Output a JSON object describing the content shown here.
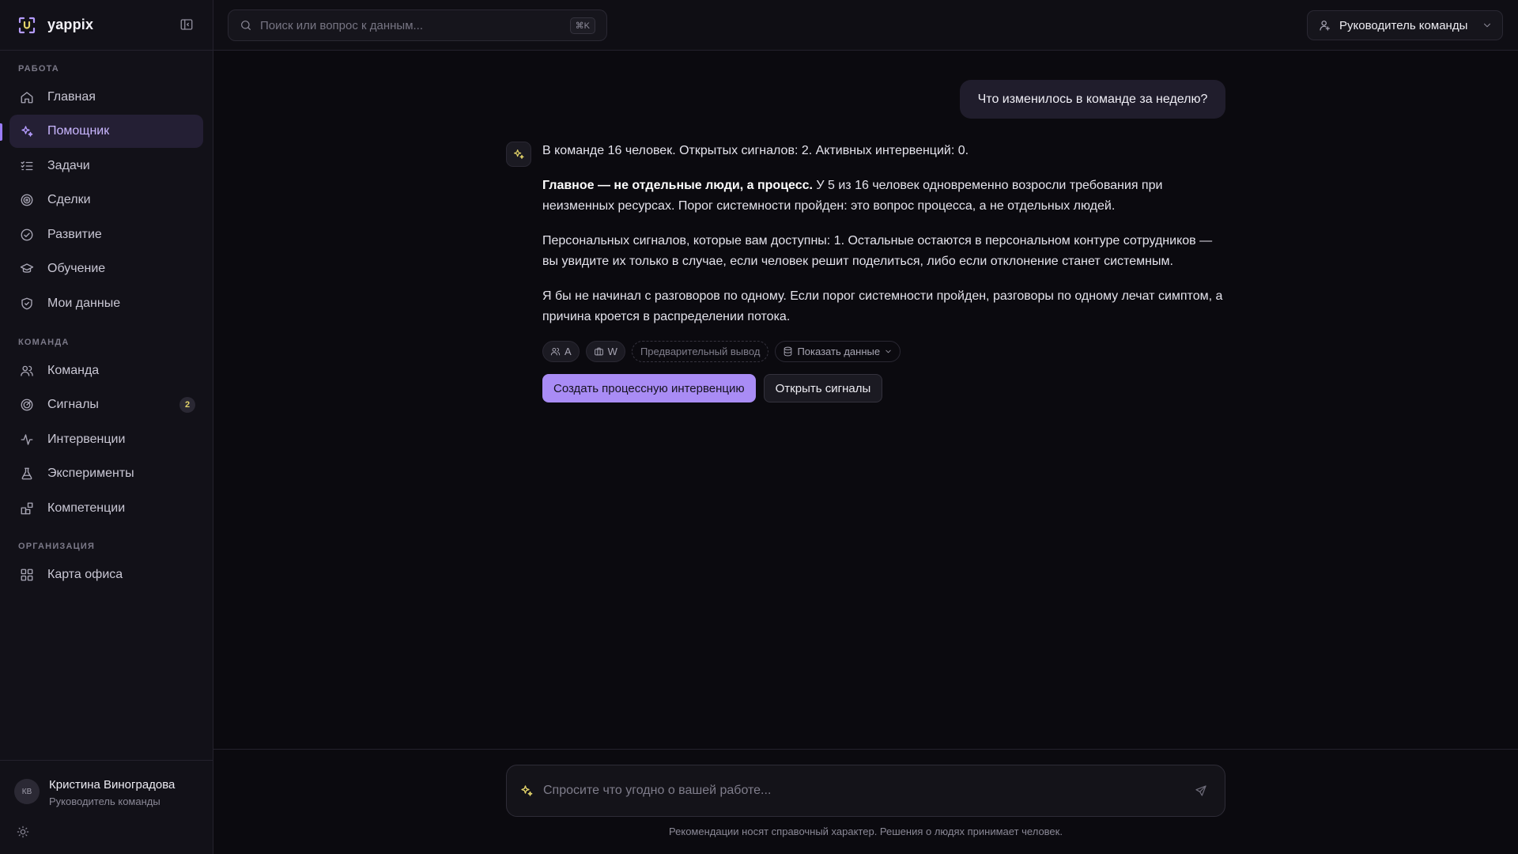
{
  "app": {
    "name": "yappix"
  },
  "colors": {
    "accent": "#a98cf5",
    "active_nav_bg": "#241f34",
    "badge_text": "#e2d36a",
    "background": "#0b0a0f"
  },
  "sidebar": {
    "sections": [
      {
        "title": "РАБОТА",
        "items": [
          {
            "label": "Главная",
            "icon": "home-icon"
          },
          {
            "label": "Помощник",
            "icon": "sparkles-icon",
            "active": true
          },
          {
            "label": "Задачи",
            "icon": "list-check-icon"
          },
          {
            "label": "Сделки",
            "icon": "target-icon"
          },
          {
            "label": "Развитие",
            "icon": "check-circle-icon"
          },
          {
            "label": "Обучение",
            "icon": "graduation-cap-icon"
          },
          {
            "label": "Мои данные",
            "icon": "shield-icon"
          }
        ]
      },
      {
        "title": "КОМАНДА",
        "items": [
          {
            "label": "Команда",
            "icon": "users-icon"
          },
          {
            "label": "Сигналы",
            "icon": "radar-icon",
            "badge": "2"
          },
          {
            "label": "Интервенции",
            "icon": "activity-icon"
          },
          {
            "label": "Эксперименты",
            "icon": "flask-icon"
          },
          {
            "label": "Компетенции",
            "icon": "blocks-icon"
          }
        ]
      },
      {
        "title": "ОРГАНИЗАЦИЯ",
        "items": [
          {
            "label": "Карта офиса",
            "icon": "grid-icon"
          }
        ]
      }
    ],
    "user": {
      "initials": "КВ",
      "name": "Кристина Виноградова",
      "role": "Руководитель команды"
    }
  },
  "topbar": {
    "search_placeholder": "Поиск или вопрос к данным...",
    "search_shortcut": "⌘K",
    "role_selector": "Руководитель команды"
  },
  "chat": {
    "user_message": "Что изменилось в команде за неделю?",
    "answer": {
      "p1": "В команде 16 человек. Открытых сигналов: 2. Активных интервенций: 0.",
      "p2_bold": "Главное — не отдельные люди, а процесс.",
      "p2_rest": " У 5 из 16 человек одновременно возросли требования при неизменных ресурсах. Порог системности пройден: это вопрос процесса, а не отдельных людей.",
      "p3": "Персональных сигналов, которые вам доступны: 1. Остальные остаются в персональном контуре сотрудников — вы увидите их только в случае, если человек решит поделиться, либо если отклонение станет системным.",
      "p4": "Я бы не начинал с разговоров по одному. Если порог системности пройден, разговоры по одному лечат симптом, а причина кроется в распределении потока."
    },
    "chips": {
      "chip1": "A",
      "chip2": "W",
      "chip3": "Предварительный вывод",
      "chip4": "Показать данные"
    },
    "actions": {
      "primary": "Создать процессную интервенцию",
      "secondary": "Открыть сигналы"
    }
  },
  "composer": {
    "placeholder": "Спросите что угодно о вашей работе...",
    "disclaimer": "Рекомендации носят справочный характер. Решения о людях принимает человек."
  }
}
